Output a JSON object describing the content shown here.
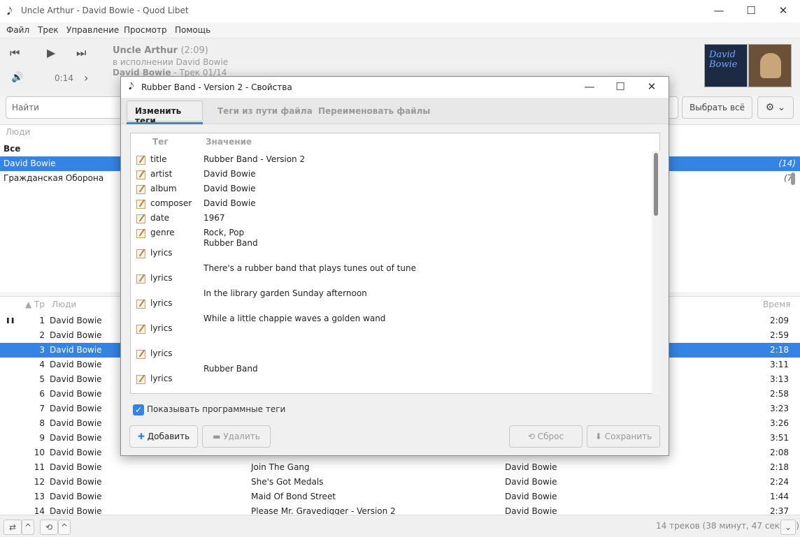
{
  "window": {
    "title": "Uncle Arthur - David Bowie - Quod Libet"
  },
  "menu": [
    "Файл",
    "Трек",
    "Управление",
    "Просмотр",
    "Помощь"
  ],
  "player": {
    "title": "Uncle Arthur",
    "length": "(2:09)",
    "by": "в исполнении David Bowie",
    "album": "David Bowie",
    "track_info": " - Трек 01/14",
    "elapsed": "0:14"
  },
  "search": {
    "placeholder": "Найти",
    "select_all": "Выбрать всё"
  },
  "people": {
    "header": "Люди",
    "all": "Все",
    "items": [
      {
        "name": "David Bowie",
        "count": "(14)"
      },
      {
        "name": "Гражданская Оборона",
        "count": "(7)"
      }
    ]
  },
  "tracklist": {
    "col_track": "Тр",
    "col_people": "Люди",
    "col_time": "Время",
    "rows": [
      {
        "num": "1",
        "artist": "David Bowie",
        "title": "",
        "album": "",
        "time": "2:09"
      },
      {
        "num": "2",
        "artist": "David Bowie",
        "title": "",
        "album": "",
        "time": "2:59"
      },
      {
        "num": "3",
        "artist": "David Bowie",
        "title": "",
        "album": "",
        "time": "2:18"
      },
      {
        "num": "4",
        "artist": "David Bowie",
        "title": "",
        "album": "",
        "time": "3:11"
      },
      {
        "num": "5",
        "artist": "David Bowie",
        "title": "",
        "album": "",
        "time": "3:13"
      },
      {
        "num": "6",
        "artist": "David Bowie",
        "title": "",
        "album": "",
        "time": "2:58"
      },
      {
        "num": "7",
        "artist": "David Bowie",
        "title": "",
        "album": "",
        "time": "3:23"
      },
      {
        "num": "8",
        "artist": "David Bowie",
        "title": "",
        "album": "",
        "time": "3:26"
      },
      {
        "num": "9",
        "artist": "David Bowie",
        "title": "",
        "album": "",
        "time": "3:51"
      },
      {
        "num": "10",
        "artist": "David Bowie",
        "title": "",
        "album": "",
        "time": "2:08"
      },
      {
        "num": "11",
        "artist": "David Bowie",
        "title": "Join The Gang",
        "album": "David Bowie",
        "time": "2:18"
      },
      {
        "num": "12",
        "artist": "David Bowie",
        "title": "She's Got Medals",
        "album": "David Bowie",
        "time": "2:24"
      },
      {
        "num": "13",
        "artist": "David Bowie",
        "title": "Maid Of Bond Street",
        "album": "David Bowie",
        "time": "1:44"
      },
      {
        "num": "14",
        "artist": "David Bowie",
        "title": "Please Mr. Gravedigger - Version 2",
        "album": "David Bowie",
        "time": "2:37"
      }
    ]
  },
  "status": {
    "summary": "14 треков (38 минут, 47 секунд)"
  },
  "dialog": {
    "title": "Rubber Band - Version 2 - Свойства",
    "tabs": [
      "Изменить теги",
      "Теги из пути файла",
      "Переименовать файлы"
    ],
    "col_tag": "Тег",
    "col_value": "Значение",
    "tags": [
      {
        "key": "title",
        "value": "Rubber Band - Version 2"
      },
      {
        "key": "artist",
        "value": "David Bowie"
      },
      {
        "key": "album",
        "value": "David Bowie"
      },
      {
        "key": "composer",
        "value": "David Bowie"
      },
      {
        "key": "date",
        "value": "1967"
      },
      {
        "key": "genre",
        "value": "Rock, Pop"
      },
      {
        "key": "lyrics",
        "value": "Rubber Band"
      },
      {
        "key": "lyrics",
        "value": "There's a rubber band that plays tunes out of tune"
      },
      {
        "key": "lyrics",
        "value": "In the library garden Sunday afternoon"
      },
      {
        "key": "lyrics",
        "value": "While a little chappie waves a golden wand"
      },
      {
        "key": "lyrics",
        "value": ""
      },
      {
        "key": "lyrics",
        "value": "Rubber Band"
      }
    ],
    "show_program_tags": "Показывать программные теги",
    "add": "Добавить",
    "remove": "Удалить",
    "reset": "Сброс",
    "save": "Сохранить"
  }
}
